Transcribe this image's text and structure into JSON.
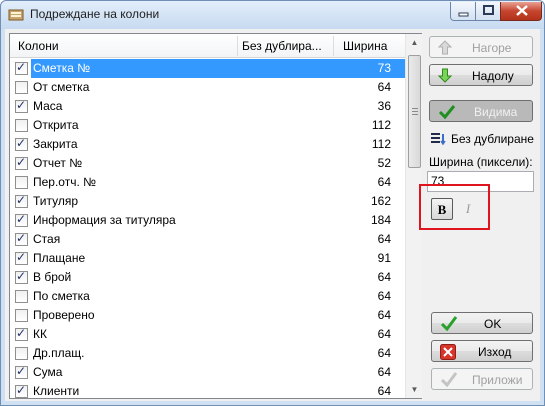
{
  "window": {
    "title": "Подреждане на колони",
    "accent_color": "#3399ff",
    "highlight_color": "#e0141e"
  },
  "columns_list": {
    "headers": {
      "name": "Колони",
      "no_dup": "Без дублира...",
      "width": "Ширина"
    },
    "rows": [
      {
        "checked": true,
        "name": "Сметка №",
        "width": "73",
        "selected": true
      },
      {
        "checked": false,
        "name": "От сметка",
        "width": "64"
      },
      {
        "checked": true,
        "name": "Маса",
        "width": "36"
      },
      {
        "checked": false,
        "name": "Открита",
        "width": "112"
      },
      {
        "checked": true,
        "name": "Закрита",
        "width": "112"
      },
      {
        "checked": true,
        "name": "Отчет №",
        "width": "52"
      },
      {
        "checked": false,
        "name": "Пер.отч. №",
        "width": "64"
      },
      {
        "checked": true,
        "name": "Титуляр",
        "width": "162"
      },
      {
        "checked": true,
        "name": "Информация за титуляра",
        "width": "184"
      },
      {
        "checked": true,
        "name": "Стая",
        "width": "64"
      },
      {
        "checked": true,
        "name": "Плащане",
        "width": "91"
      },
      {
        "checked": true,
        "name": "В брой",
        "width": "64"
      },
      {
        "checked": false,
        "name": "По сметка",
        "width": "64"
      },
      {
        "checked": false,
        "name": "Проверено",
        "width": "64"
      },
      {
        "checked": true,
        "name": "КК",
        "width": "64"
      },
      {
        "checked": false,
        "name": "Др.плащ.",
        "width": "64"
      },
      {
        "checked": true,
        "name": "Сума",
        "width": "64"
      },
      {
        "checked": true,
        "name": "Клиенти",
        "width": "64"
      }
    ]
  },
  "panel": {
    "up_label": "Нагоре",
    "down_label": "Надолу",
    "visible_label": "Видима",
    "no_dup_label": "Без дублиране",
    "width_label": "Ширина (пиксели):",
    "width_value": "73",
    "bold_label": "B",
    "italic_label": "I",
    "ok_label": "OK",
    "exit_label": "Изход",
    "apply_label": "Приложи"
  }
}
